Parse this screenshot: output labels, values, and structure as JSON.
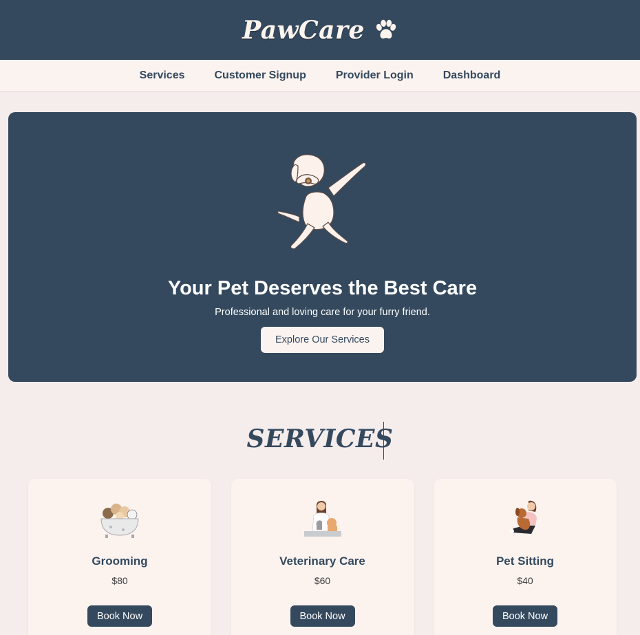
{
  "brand": {
    "name": "PawCare",
    "icon": "paw-icon"
  },
  "nav": {
    "items": [
      {
        "label": "Services"
      },
      {
        "label": "Customer Signup"
      },
      {
        "label": "Provider Login"
      },
      {
        "label": "Dashboard"
      }
    ]
  },
  "hero": {
    "image": "dabbing-dog-illustration",
    "title": "Your Pet Deserves the Best Care",
    "subtitle": "Professional and loving care for your furry friend.",
    "cta_label": "Explore Our Services"
  },
  "services": {
    "heading": "SERVICES",
    "items": [
      {
        "name": "Grooming",
        "price": "$80",
        "button": "Book Now",
        "image": "grooming-pets-in-tub-illustration"
      },
      {
        "name": "Veterinary Care",
        "price": "$60",
        "button": "Book Now",
        "image": "veterinarian-with-pets-illustration"
      },
      {
        "name": "Pet Sitting",
        "price": "$40",
        "button": "Book Now",
        "image": "sitter-hugging-dog-illustration"
      }
    ]
  },
  "colors": {
    "primary": "#34495e",
    "cream": "#fbf3ef",
    "page_background": "#f5ecec"
  }
}
